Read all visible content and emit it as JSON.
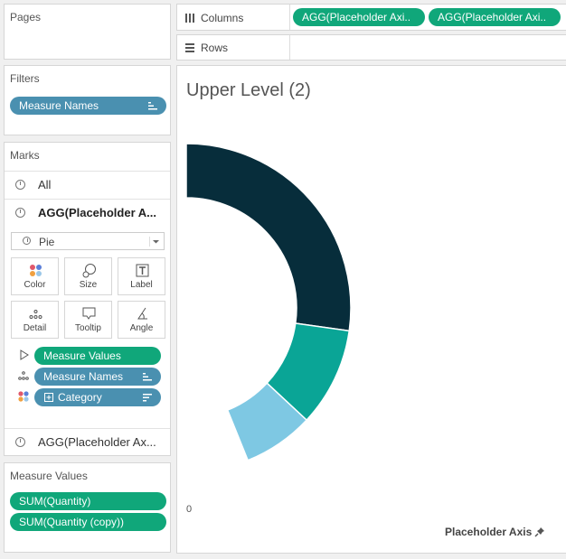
{
  "shelves": {
    "columns_label": "Columns",
    "rows_label": "Rows",
    "columns_pills": [
      "AGG(Placeholder Axi..",
      "AGG(Placeholder Axi.."
    ]
  },
  "pages": {
    "title": "Pages"
  },
  "filters": {
    "title": "Filters",
    "pill": "Measure Names"
  },
  "marks": {
    "title": "Marks",
    "all_label": "All",
    "layer1_label": "AGG(Placeholder A...",
    "mark_type": "Pie",
    "buttons": [
      "Color",
      "Size",
      "Label",
      "Detail",
      "Tooltip",
      "Angle"
    ],
    "fields": [
      "Measure Values",
      "Measure Names",
      "Category"
    ],
    "layer2_label": "AGG(Placeholder Ax..."
  },
  "measure_values": {
    "title": "Measure Values",
    "pills": [
      "SUM(Quantity)",
      "SUM(Quantity (copy))"
    ]
  },
  "view": {
    "title": "Upper Level (2)",
    "axis_zero": "0",
    "axis_title": "Placeholder Axis"
  },
  "chart_data": {
    "type": "pie",
    "categories": [
      "",
      "",
      ""
    ],
    "values": [
      50,
      17,
      12
    ],
    "colors": [
      "#072d3b",
      "#0aa596",
      "#7ec8e3"
    ],
    "title": "Upper Level (2)",
    "xlabel": "Placeholder Axis"
  },
  "colors": {
    "green_pill": "#10a77a",
    "blue_pill": "#4a90b0"
  }
}
